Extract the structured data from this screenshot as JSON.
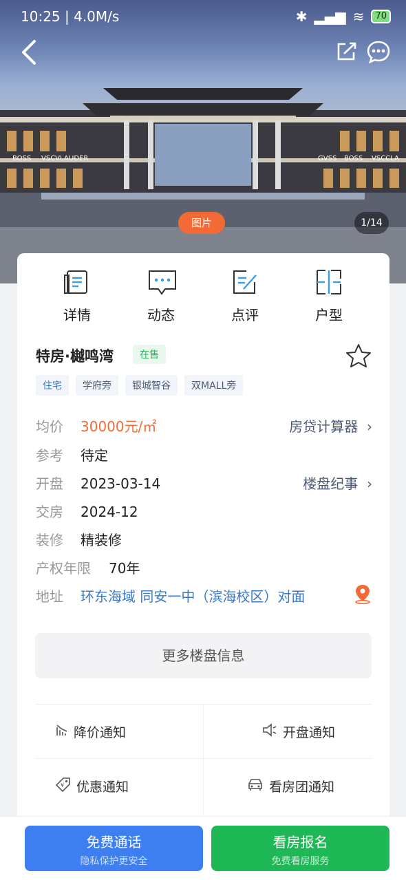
{
  "status_bar": {
    "time": "10:25",
    "network_speed": "4.0M/s",
    "battery": "70"
  },
  "gallery": {
    "photo_label": "图片",
    "counter": "1/14",
    "sign_texts": [
      "BOSS",
      "VSCVLA",
      "UDER",
      "GVSS",
      "BOSS",
      "VSCCLA"
    ]
  },
  "tabs": [
    {
      "label": "详情",
      "icon": "document-list-icon"
    },
    {
      "label": "动态",
      "icon": "message-dots-icon"
    },
    {
      "label": "点评",
      "icon": "edit-note-icon"
    },
    {
      "label": "户型",
      "icon": "floorplan-icon"
    }
  ],
  "property": {
    "name": "特房·樾鸣湾",
    "status": "在售",
    "tags": [
      "住宅",
      "学府旁",
      "银城智谷",
      "双MALL旁"
    ]
  },
  "info": {
    "price_label": "均价",
    "price_value": "30000元/㎡",
    "calculator_link": "房贷计算器",
    "reference_label": "参考",
    "reference_value": "待定",
    "opening_label": "开盘",
    "opening_value": "2023-03-14",
    "history_link": "楼盘纪事",
    "delivery_label": "交房",
    "delivery_value": "2024-12",
    "decoration_label": "装修",
    "decoration_value": "精装修",
    "tenure_label": "产权年限",
    "tenure_value": "70年",
    "address_label": "地址",
    "address_value": "环东海域 同安一中（滨海校区）对面"
  },
  "more_info_button": "更多楼盘信息",
  "notifications": {
    "price_drop": "降价通知",
    "opening": "开盘通知",
    "discount": "优惠通知",
    "tour_group": "看房团通知"
  },
  "bottom_bar": {
    "call_main": "免费通话",
    "call_sub": "隐私保护更安全",
    "signup_main": "看房报名",
    "signup_sub": "免费看房服务"
  },
  "colors": {
    "accent_orange": "#f26b36",
    "link_blue": "#3a78c8",
    "call_blue": "#3d7ef0",
    "signup_green": "#1fb856"
  }
}
